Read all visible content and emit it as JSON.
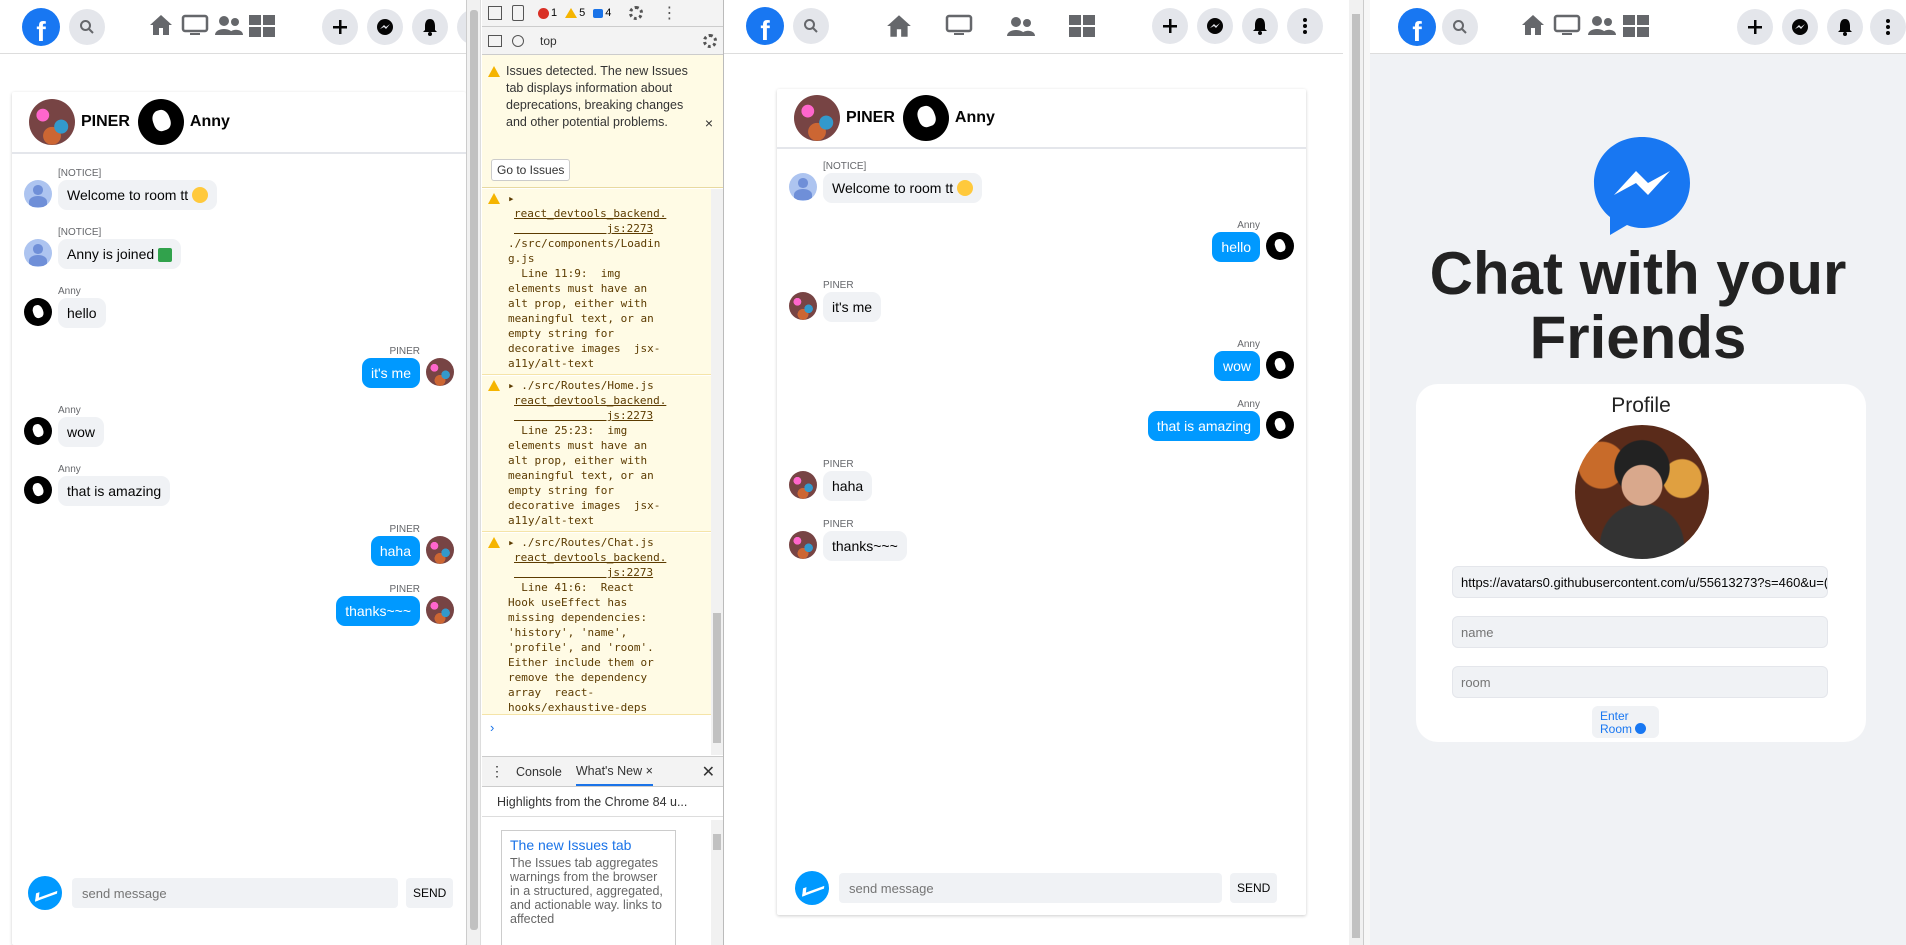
{
  "chat": {
    "user1": "PINER",
    "user2": "Anny",
    "messages": [
      {
        "sender": "[NOTICE]",
        "text": "Welcome to room tt",
        "side": "left",
        "avatar": "default",
        "style": "gray",
        "emoji": "star-struck-emoji"
      },
      {
        "sender": "[NOTICE]",
        "text": "Anny is joined",
        "side": "left",
        "avatar": "default",
        "style": "gray",
        "emoji": "check-emoji"
      },
      {
        "sender": "Anny",
        "text": "hello",
        "side": "left",
        "avatar": "anny",
        "style": "gray"
      },
      {
        "sender": "PINER",
        "text": "it's me",
        "side": "right",
        "avatar": "piner",
        "style": "blue"
      },
      {
        "sender": "Anny",
        "text": "wow",
        "side": "left",
        "avatar": "anny",
        "style": "gray"
      },
      {
        "sender": "Anny",
        "text": "that is amazing",
        "side": "left",
        "avatar": "anny",
        "style": "gray"
      },
      {
        "sender": "PINER",
        "text": "haha",
        "side": "right",
        "avatar": "piner",
        "style": "blue"
      },
      {
        "sender": "PINER",
        "text": "thanks~~~",
        "side": "right",
        "avatar": "piner",
        "style": "blue"
      }
    ],
    "messages2": [
      {
        "sender": "[NOTICE]",
        "text": "Welcome to room tt",
        "side": "left",
        "avatar": "default",
        "style": "gray",
        "emoji": "star-struck-emoji"
      },
      {
        "sender": "Anny",
        "text": "hello",
        "side": "right",
        "avatar": "anny",
        "style": "blue"
      },
      {
        "sender": "PINER",
        "text": "it's me",
        "side": "left",
        "avatar": "piner",
        "style": "gray"
      },
      {
        "sender": "Anny",
        "text": "wow",
        "side": "right",
        "avatar": "anny",
        "style": "blue"
      },
      {
        "sender": "Anny",
        "text": "that is amazing",
        "side": "right",
        "avatar": "anny",
        "style": "blue"
      },
      {
        "sender": "PINER",
        "text": "haha",
        "side": "left",
        "avatar": "piner",
        "style": "gray"
      },
      {
        "sender": "PINER",
        "text": "thanks~~~",
        "side": "left",
        "avatar": "piner",
        "style": "gray"
      }
    ],
    "input_placeholder": "send message",
    "send_label": "SEND"
  },
  "devtools": {
    "error_count": "1",
    "warning_count": "5",
    "info_count": "4",
    "context": "top",
    "issues_banner": "Issues detected. The new Issues tab displays information about deprecations, breaking changes and other potential problems.",
    "go_to_issues": "Go to Issues",
    "entries": [
      {
        "source": "react_devtools_backend.\n              js:2273",
        "body": "./src/components/Loadin\ng.js\n  Line 11:9:  img\nelements must have an\nalt prop, either with\nmeaningful text, or an\nempty string for\ndecorative images  jsx-\na11y/alt-text"
      },
      {
        "file": "./src/Routes/Home.js",
        "source": "react_devtools_backend.\n              js:2273",
        "body": "  Line 25:23:  img\nelements must have an\nalt prop, either with\nmeaningful text, or an\nempty string for\ndecorative images  jsx-\na11y/alt-text"
      },
      {
        "file": "./src/Routes/Chat.js",
        "source": "react_devtools_backend.\n              js:2273",
        "body": "  Line 41:6:  React\nHook useEffect has\nmissing dependencies:\n'history', 'name',\n'profile', and 'room'.\nEither include them or\nremove the dependency\narray  react-\nhooks/exhaustive-deps"
      }
    ],
    "drawer_tabs": [
      "Console",
      "What's New"
    ],
    "highlights": "Highlights from the Chrome 84 u...",
    "whatsnew_title": "The new Issues tab",
    "whatsnew_body": "The Issues tab aggregates warnings from the browser in a structured, aggregated, and actionable way. links to affected"
  },
  "landing": {
    "title_line1": "Chat with your",
    "title_line2": "Friends",
    "profile_label": "Profile",
    "profile_url": "https://avatars0.githubusercontent.com/u/55613273?s=460&u=(",
    "name_placeholder": "name",
    "room_placeholder": "room",
    "enter_line1": "Enter",
    "enter_line2": "Room"
  },
  "colors": {
    "facebook_blue": "#1877f2",
    "messenger_blue": "#0099ff",
    "bubble_gray": "#f0f2f5",
    "devtools_warning_bg": "#fffbe5"
  }
}
